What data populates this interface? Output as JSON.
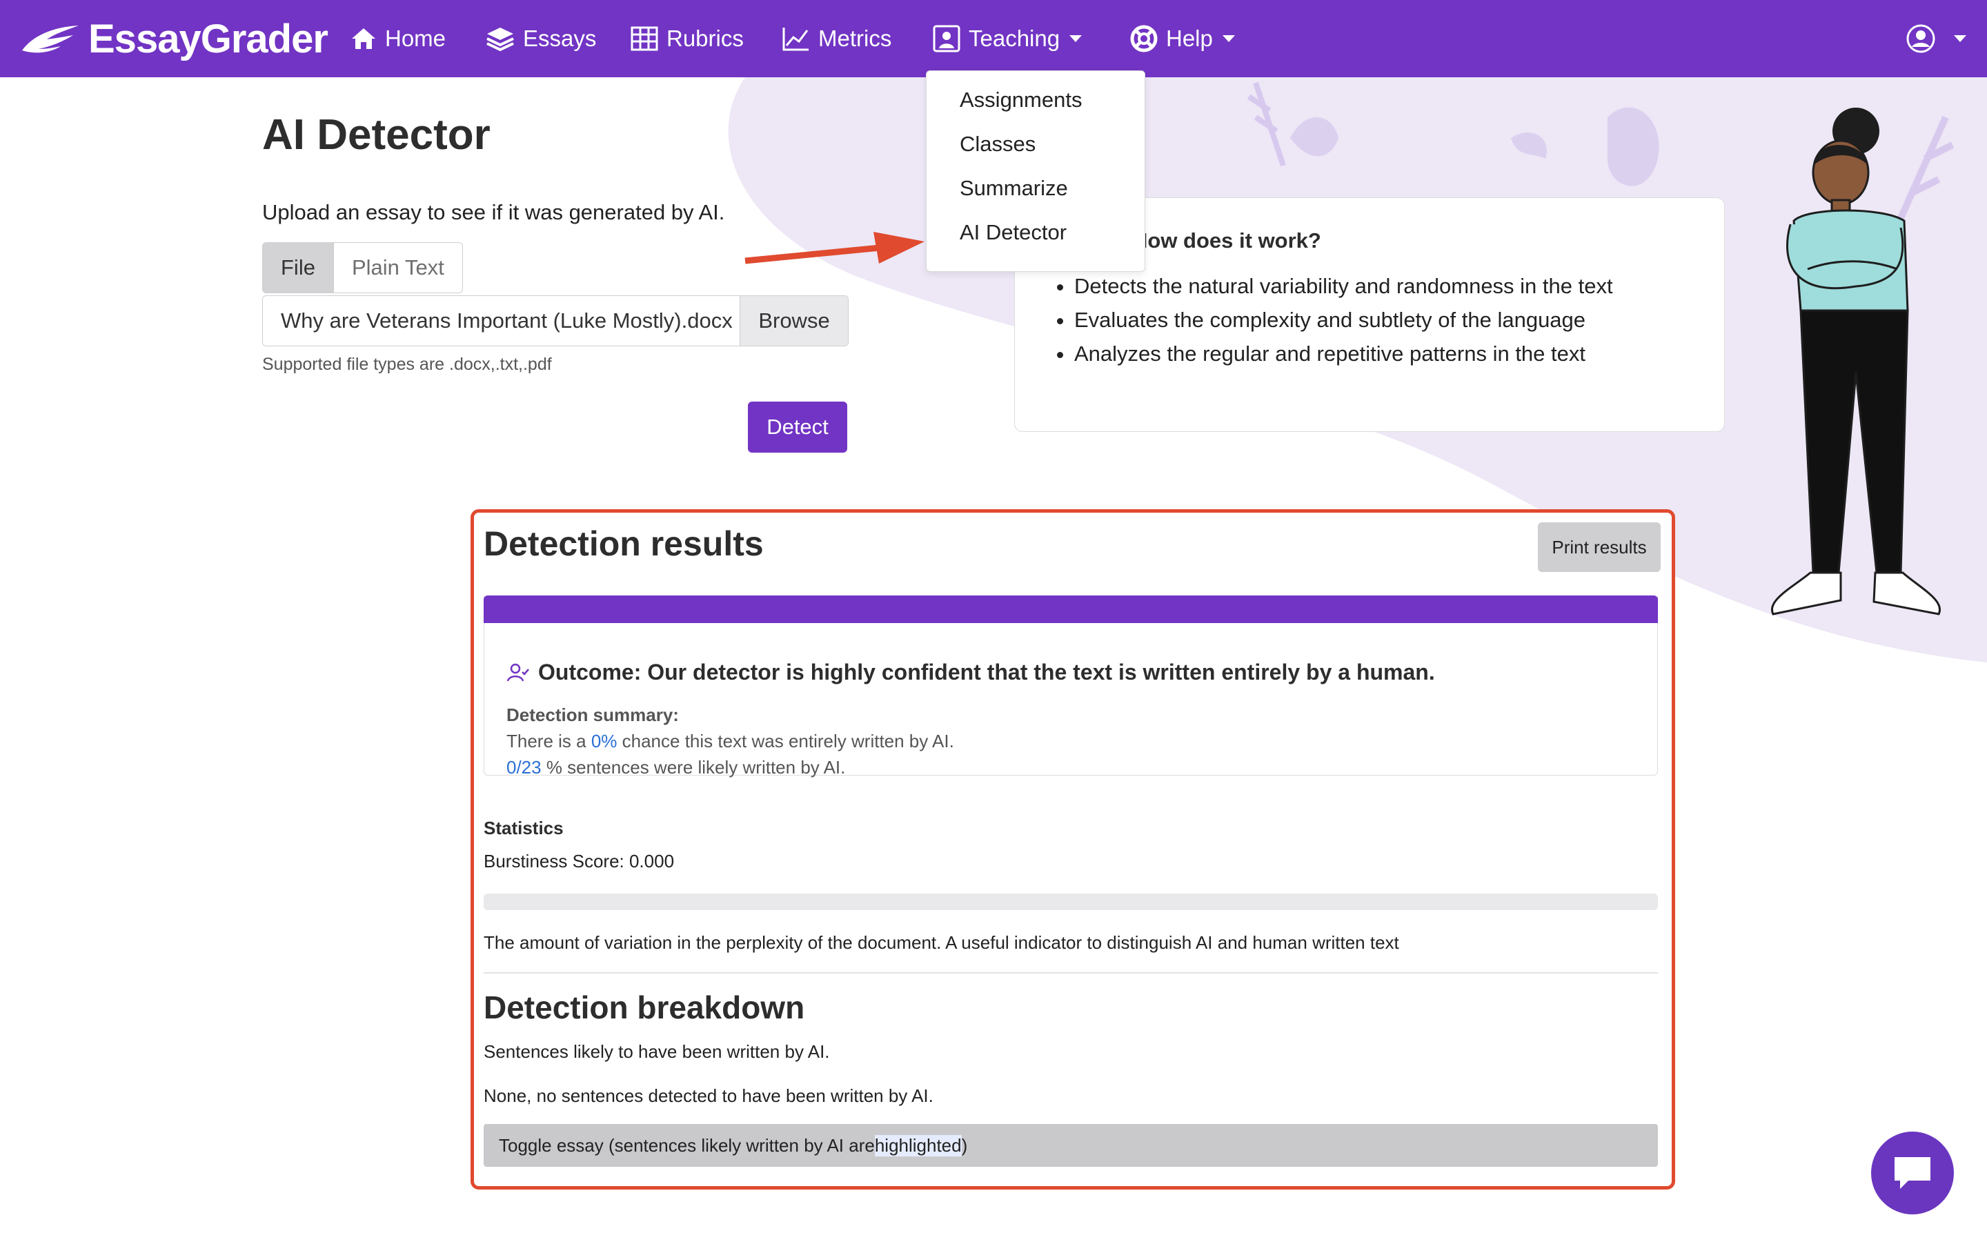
{
  "app": {
    "brand": "EssayGrader",
    "accent_color": "#7234c4"
  },
  "nav": {
    "items": [
      {
        "label": "Home",
        "icon": "home-icon"
      },
      {
        "label": "Essays",
        "icon": "layers-icon"
      },
      {
        "label": "Rubrics",
        "icon": "table-icon"
      },
      {
        "label": "Metrics",
        "icon": "chart-line-icon"
      },
      {
        "label": "Teaching",
        "icon": "user-square-icon",
        "dropdown": true
      },
      {
        "label": "Help",
        "icon": "lifebuoy-icon",
        "dropdown": true
      }
    ],
    "teaching_menu": [
      "Assignments",
      "Classes",
      "Summarize",
      "AI Detector"
    ]
  },
  "page": {
    "title": "AI Detector",
    "intro": "Upload an essay to see if it was generated by AI.",
    "tabs": [
      "File",
      "Plain Text"
    ],
    "active_tab": "File",
    "file_name": "Why are Veterans Important (Luke Mostly).docx",
    "browse_label": "Browse",
    "hint": "Supported file types are .docx,.txt,.pdf",
    "detect_label": "Detect"
  },
  "how": {
    "title": "How does it work?",
    "bullets": [
      "Detects the natural variability and randomness in the text",
      "Evaluates the complexity and subtlety of the language",
      "Analyzes the regular and repetitive patterns in the text"
    ]
  },
  "results": {
    "title": "Detection results",
    "print_label": "Print results",
    "outcome": "Outcome: Our detector is highly confident that the text is written entirely by a human.",
    "summary_head": "Detection summary:",
    "line1_pre": "There is a ",
    "line1_val": "0%",
    "line1_post": " chance this text was entirely written by AI.",
    "line2_val": "0/23",
    "line2_post": " % sentences were likely written by AI.",
    "stats_head": "Statistics",
    "burstiness": "Burstiness Score: 0.000",
    "burstiness_fraction": 0.0,
    "burstiness_desc": "The amount of variation in the perplexity of the document. A useful indicator to distinguish AI and human written text",
    "breakdown_title": "Detection breakdown",
    "breakdown_line1": "Sentences likely to have been written by AI.",
    "breakdown_line2": "None, no sentences detected to have been written by AI.",
    "toggle_pre": "Toggle essay (sentences likely written by AI are ",
    "toggle_hl": "highlighted",
    "toggle_post": ")"
  }
}
